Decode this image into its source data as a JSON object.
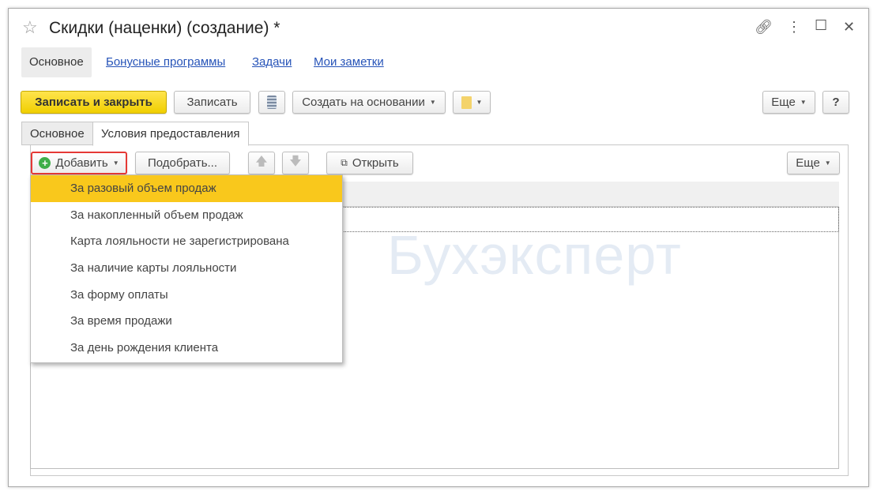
{
  "window": {
    "title": "Скидки (наценки) (создание) *"
  },
  "nav_tabs": [
    {
      "label": "Основное",
      "active": true
    },
    {
      "label": "Бонусные программы"
    },
    {
      "label": "Задачи"
    },
    {
      "label": "Мои заметки"
    }
  ],
  "toolbar": {
    "save_close": "Записать и закрыть",
    "save": "Записать",
    "create_based": "Создать на основании",
    "more": "Еще",
    "help": "?"
  },
  "tabs": [
    {
      "label": "Основное"
    },
    {
      "label": "Условия предоставления",
      "active": true
    }
  ],
  "table_toolbar": {
    "add": "Добавить",
    "pick": "Подобрать...",
    "open": "Открыть",
    "more": "Еще"
  },
  "add_menu": [
    "За разовый объем продаж",
    "За накопленный объем продаж",
    "Карта лояльности не зарегистрирована",
    "За наличие карты лояльности",
    "За форму оплаты",
    "За время продажи",
    "За день рождения клиента"
  ],
  "watermark": "Бухэксперт",
  "colors": {
    "accent": "#f9c81c",
    "link": "#2653b8",
    "highlight_border": "#e53935"
  }
}
